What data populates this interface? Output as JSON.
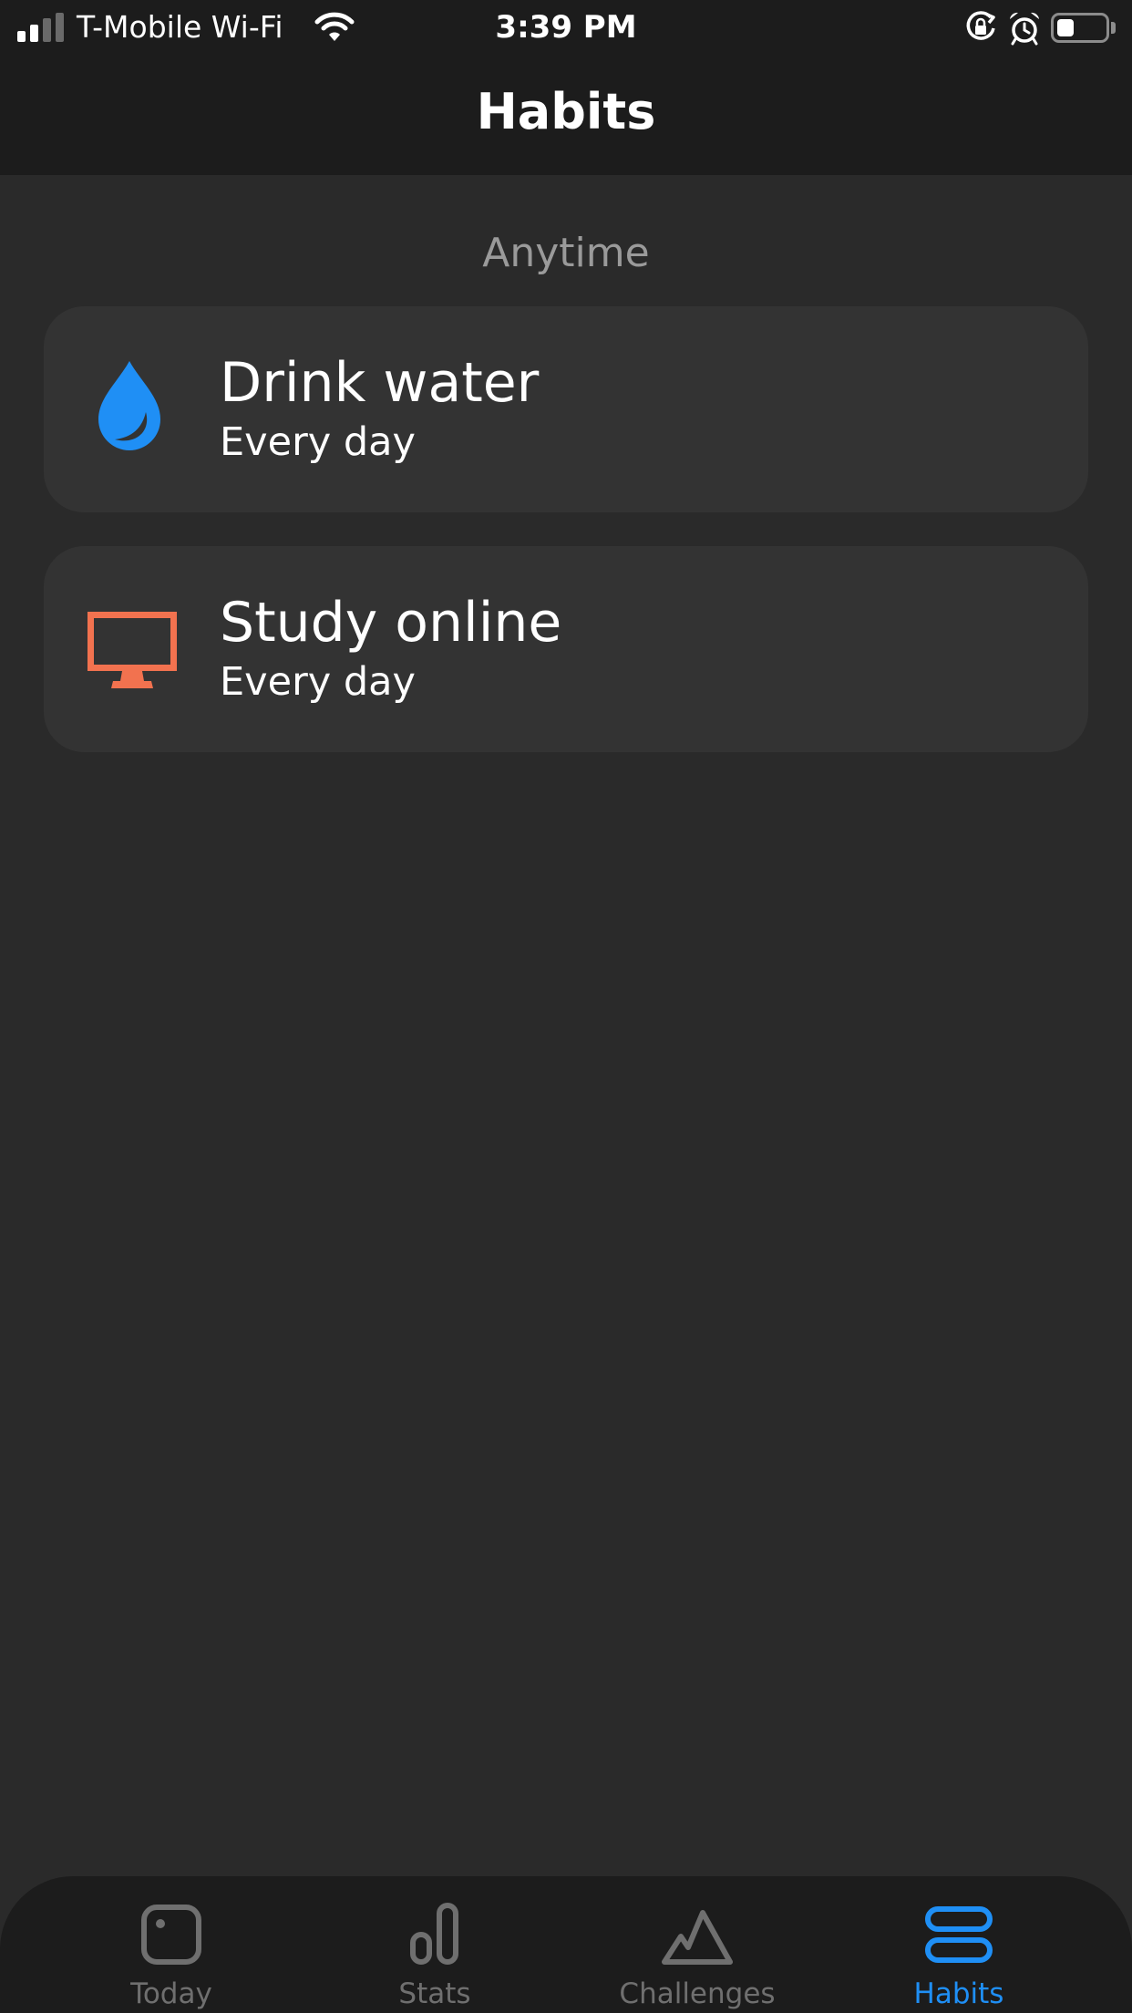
{
  "status_bar": {
    "carrier": "T-Mobile Wi-Fi",
    "time": "3:39 PM",
    "signal_bars_filled": 2,
    "signal_bars_total": 4,
    "battery_level_percent": 35,
    "icons": [
      "signal-icon",
      "wifi-icon",
      "orientation-lock-icon",
      "alarm-icon",
      "battery-icon"
    ]
  },
  "header": {
    "title": "Habits"
  },
  "sections": [
    {
      "title": "Anytime",
      "habits": [
        {
          "name": "Drink water",
          "frequency": "Every day",
          "icon": "water-drop-icon",
          "color": "#1f8ff5"
        },
        {
          "name": "Study online",
          "frequency": "Every day",
          "icon": "monitor-icon",
          "color": "#f2724f"
        }
      ]
    }
  ],
  "tab_bar": {
    "active_tab": "Habits",
    "tabs": [
      {
        "label": "Today",
        "icon": "today-icon"
      },
      {
        "label": "Stats",
        "icon": "stats-icon"
      },
      {
        "label": "Challenges",
        "icon": "challenges-icon"
      },
      {
        "label": "Habits",
        "icon": "habits-icon"
      }
    ]
  },
  "colors": {
    "background": "#2a2a2a",
    "bar_background": "#1c1c1c",
    "card_background": "#333333",
    "accent": "#1f8ff5",
    "inactive": "#6f6f6f",
    "section_header": "#9a9a9a"
  }
}
